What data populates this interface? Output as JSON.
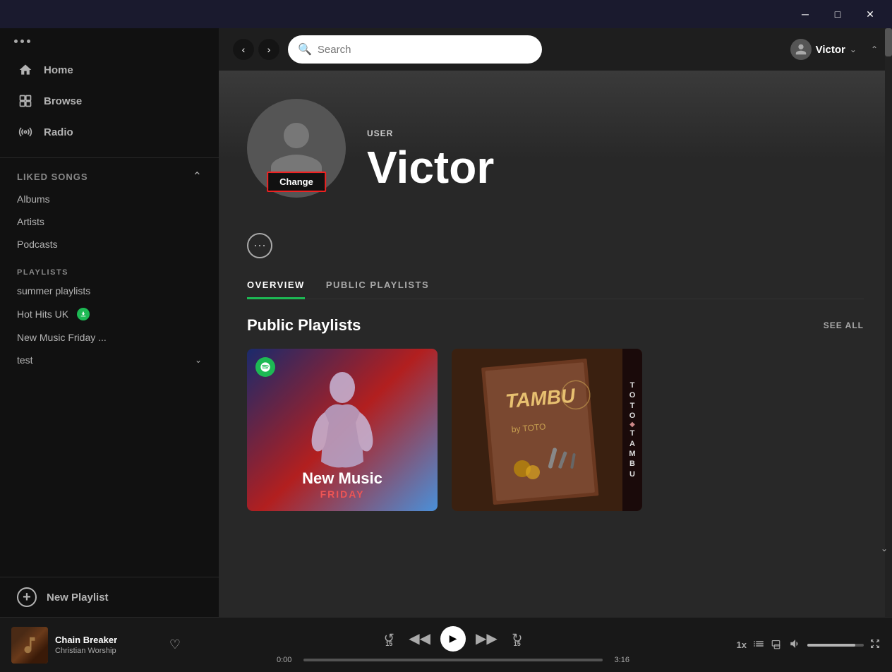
{
  "titlebar": {
    "minimize_label": "─",
    "maximize_label": "□",
    "close_label": "✕"
  },
  "sidebar": {
    "dots": "···",
    "nav_items": [
      {
        "id": "home",
        "label": "Home",
        "icon": "home"
      },
      {
        "id": "browse",
        "label": "Browse",
        "icon": "browse"
      },
      {
        "id": "radio",
        "label": "Radio",
        "icon": "radio"
      }
    ],
    "library_section": "Liked Songs",
    "library_sub": [
      {
        "label": "Albums"
      },
      {
        "label": "Artists"
      },
      {
        "label": "Podcasts"
      }
    ],
    "playlists_label": "PLAYLISTS",
    "playlists": [
      {
        "label": "summer playlists",
        "badge": null
      },
      {
        "label": "Hot Hits UK",
        "badge": "download"
      },
      {
        "label": "New Music Friday ...",
        "badge": null
      },
      {
        "label": "test",
        "badge": "expand"
      }
    ],
    "new_playlist_label": "New Playlist"
  },
  "topnav": {
    "search_placeholder": "Search",
    "user_name": "Victor"
  },
  "profile": {
    "type_label": "USER",
    "name": "Victor",
    "change_label": "Change"
  },
  "tabs": [
    {
      "id": "overview",
      "label": "OVERVIEW",
      "active": true
    },
    {
      "id": "public_playlists",
      "label": "PUBLIC PLAYLISTS",
      "active": false
    }
  ],
  "playlists_section": {
    "title": "Public Playlists",
    "see_all_label": "SEE ALL",
    "cards": [
      {
        "id": "new-music-friday",
        "title_main": "New Music",
        "title_sub": "FRIDAY",
        "type": "spotify"
      },
      {
        "id": "toto-tambu",
        "title": "TAMBU",
        "title_sub": "TOTO",
        "type": "album"
      }
    ]
  },
  "player": {
    "song_title": "Chain Breaker",
    "song_artist": "Christian Worship",
    "time_current": "0:00",
    "time_total": "3:16",
    "progress_percent": 0,
    "volume_percent": 85,
    "speed_label": "1x"
  }
}
